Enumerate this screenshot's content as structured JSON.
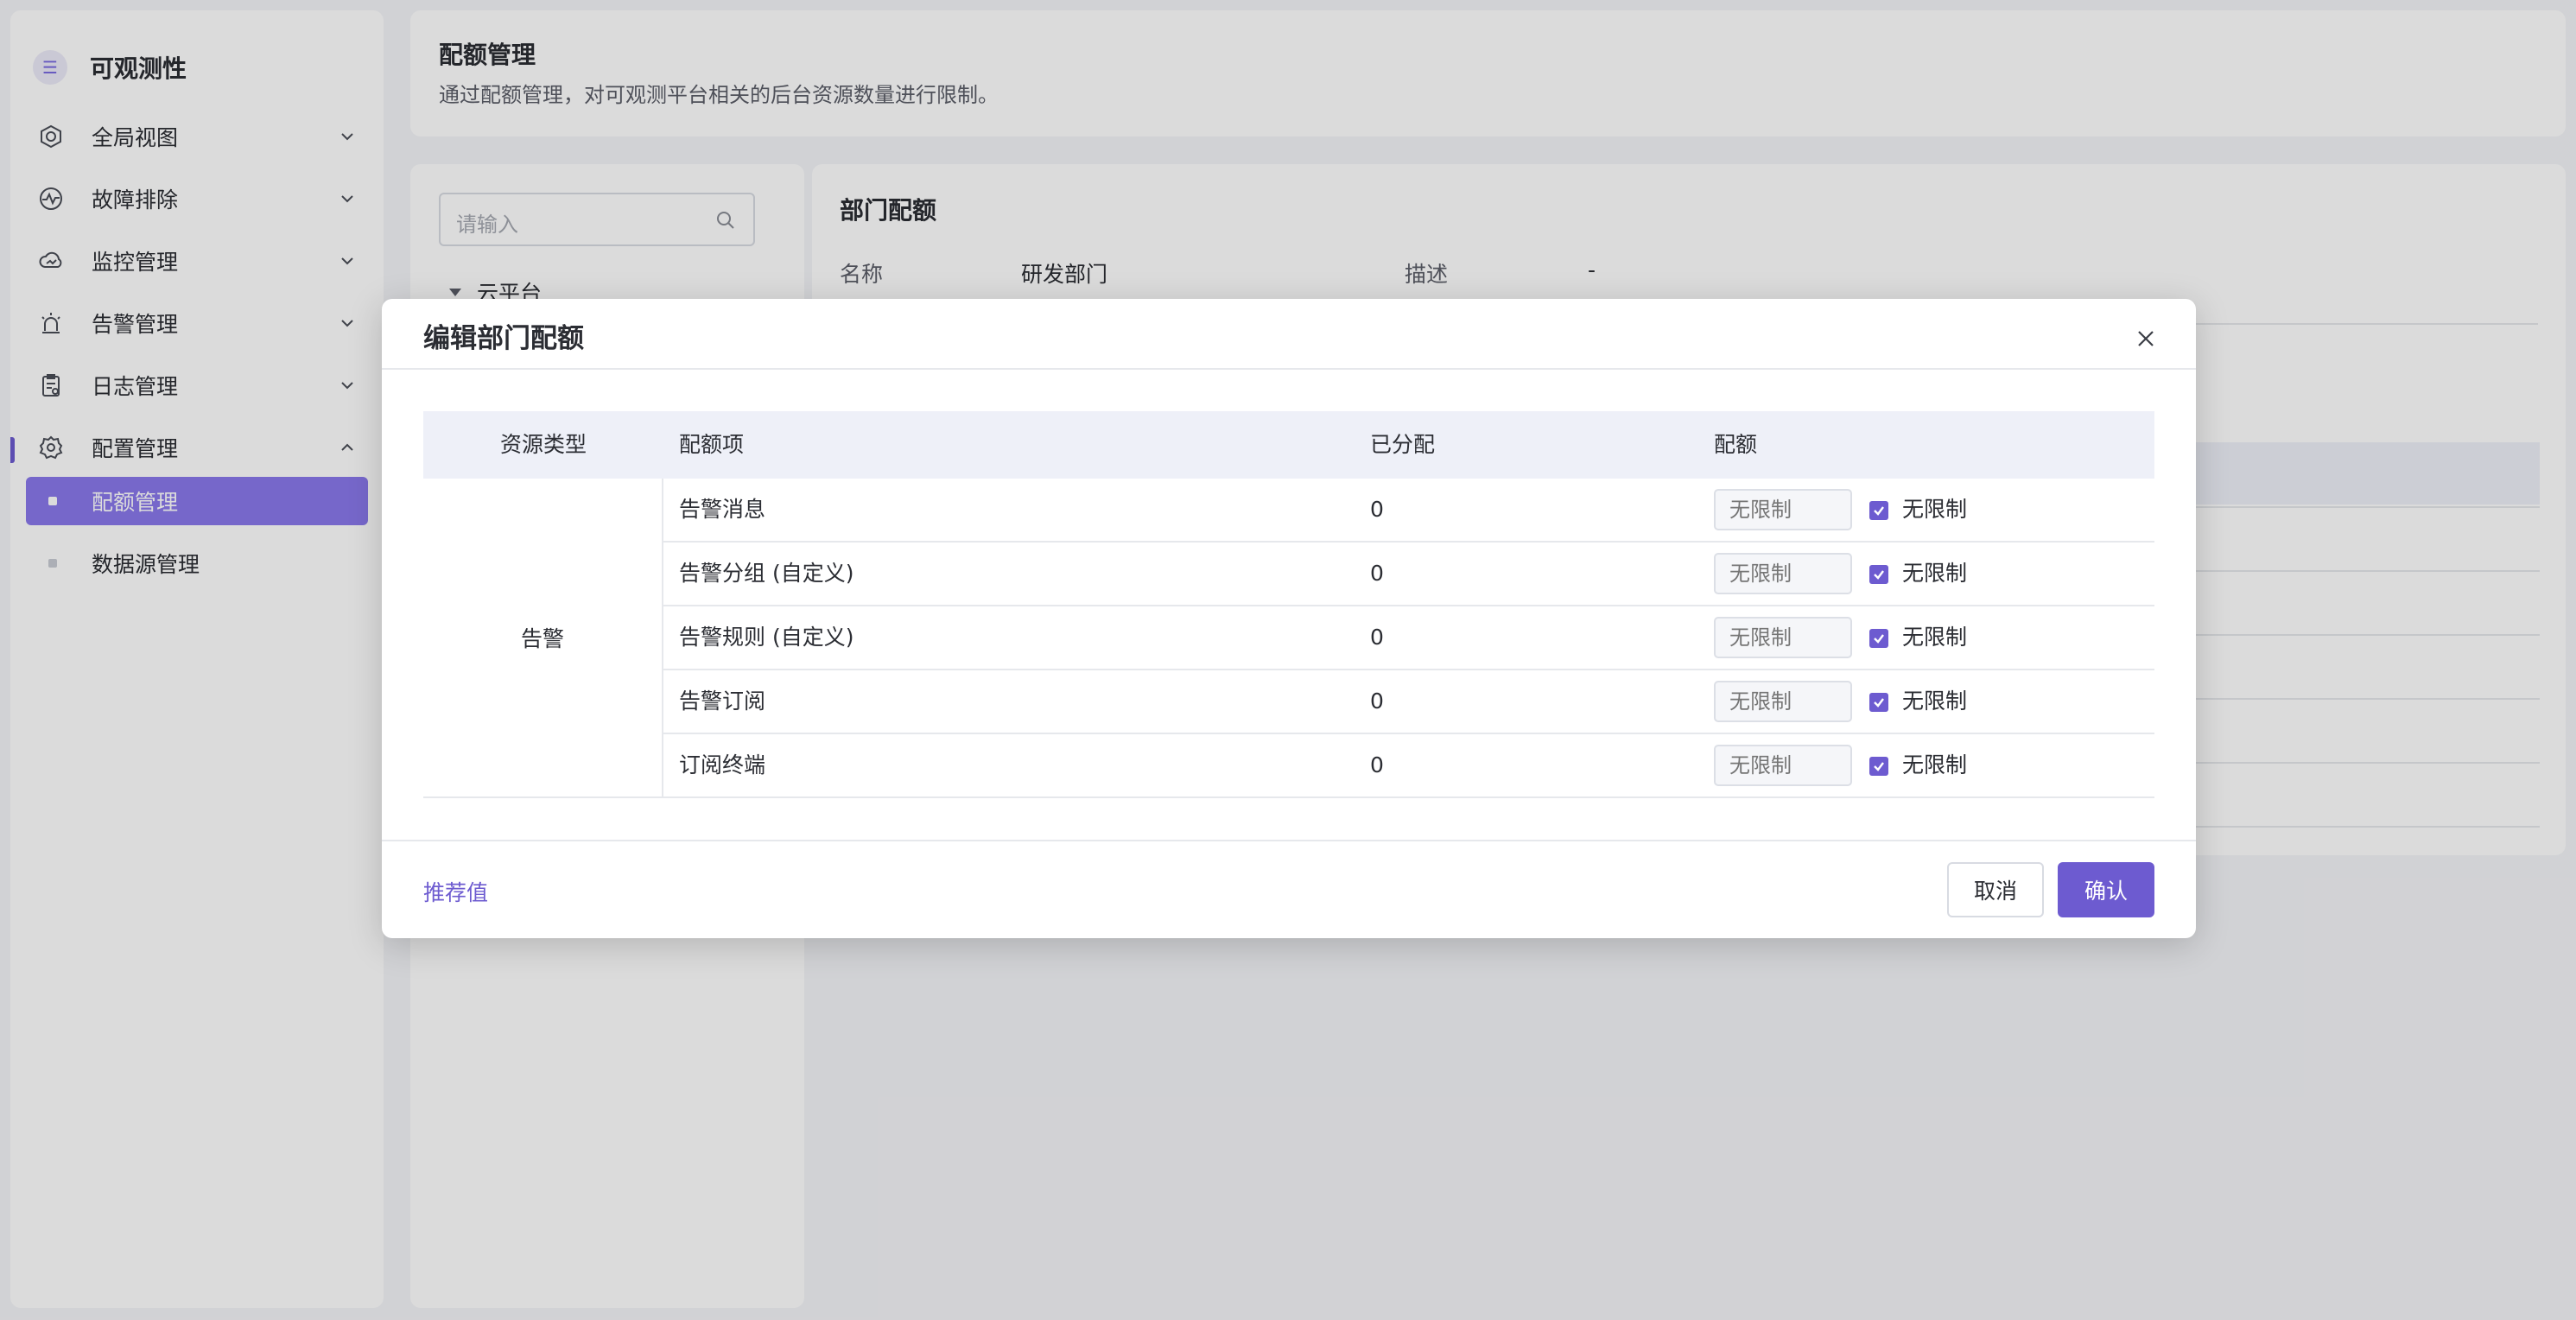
{
  "app": {
    "title": "可观测性"
  },
  "colors": {
    "accent": "#6d5bd0",
    "sidebar_active": "#8a79ec",
    "table_header": "#eef0f8"
  },
  "sidebar": {
    "items": [
      {
        "label": "全局视图",
        "icon": "hexagon-gear-icon",
        "expanded": false
      },
      {
        "label": "故障排除",
        "icon": "pulse-icon",
        "expanded": false
      },
      {
        "label": "监控管理",
        "icon": "cloud-monitor-icon",
        "expanded": false
      },
      {
        "label": "告警管理",
        "icon": "alarm-siren-icon",
        "expanded": false
      },
      {
        "label": "日志管理",
        "icon": "log-clipboard-icon",
        "expanded": false
      },
      {
        "label": "配置管理",
        "icon": "settings-gear-icon",
        "expanded": true
      }
    ],
    "sub_items": [
      {
        "label": "配额管理",
        "active": true
      },
      {
        "label": "数据源管理",
        "active": false
      }
    ]
  },
  "header": {
    "title": "配额管理",
    "description": "通过配额管理，对可观测平台相关的后台资源数量进行限制。"
  },
  "tree": {
    "search_placeholder": "请输入",
    "root_label": "云平台"
  },
  "detail": {
    "title": "部门配额",
    "name_label": "名称",
    "name_value": "研发部门",
    "desc_label": "描述",
    "desc_value": "-"
  },
  "modal": {
    "title": "编辑部门配额",
    "columns": {
      "resource_type": "资源类型",
      "quota_item": "配额项",
      "allocated": "已分配",
      "quota": "配额"
    },
    "resource_type": "告警",
    "rows": [
      {
        "item": "告警消息",
        "allocated": "0",
        "placeholder": "无限制",
        "unlimited_label": "无限制",
        "unlimited": true
      },
      {
        "item": "告警分组 (自定义)",
        "allocated": "0",
        "placeholder": "无限制",
        "unlimited_label": "无限制",
        "unlimited": true
      },
      {
        "item": "告警规则 (自定义)",
        "allocated": "0",
        "placeholder": "无限制",
        "unlimited_label": "无限制",
        "unlimited": true
      },
      {
        "item": "告警订阅",
        "allocated": "0",
        "placeholder": "无限制",
        "unlimited_label": "无限制",
        "unlimited": true
      },
      {
        "item": "订阅终端",
        "allocated": "0",
        "placeholder": "无限制",
        "unlimited_label": "无限制",
        "unlimited": true
      }
    ],
    "recommend_label": "推荐值",
    "cancel_label": "取消",
    "confirm_label": "确认"
  }
}
